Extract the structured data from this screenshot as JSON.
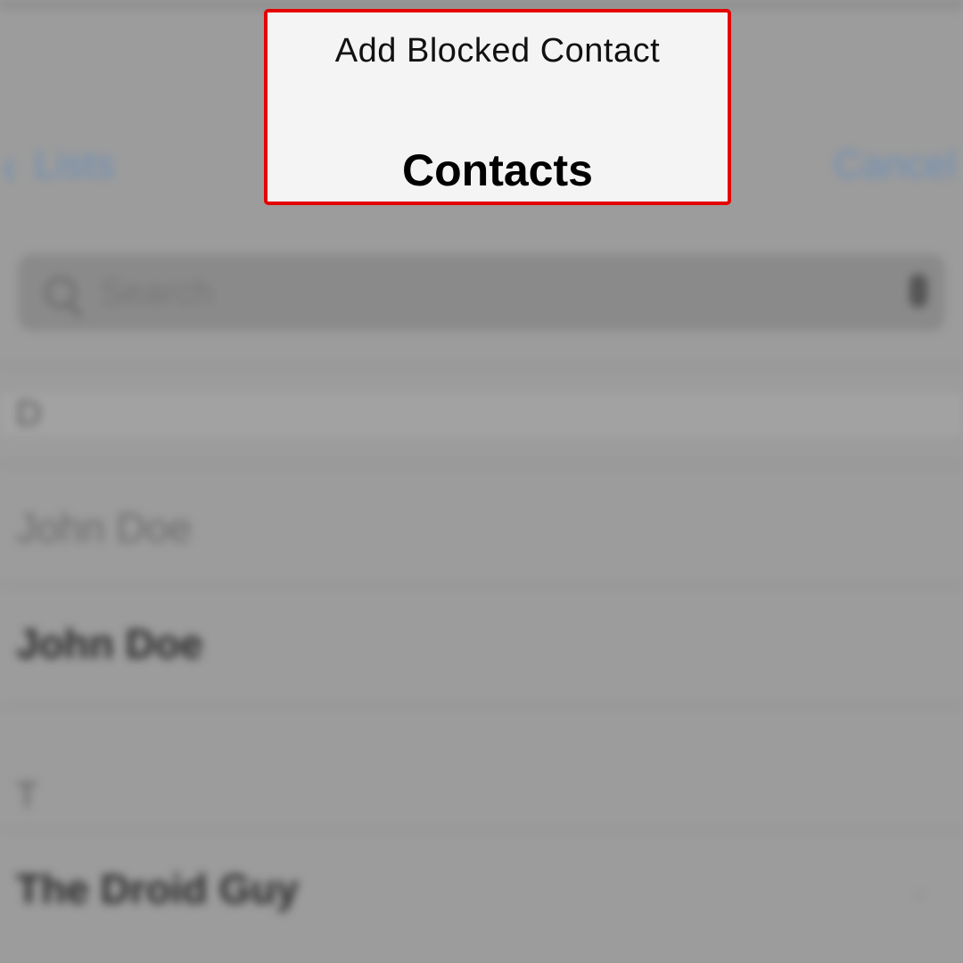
{
  "header": {
    "prompt": "Add Blocked Contact",
    "title": "Contacts"
  },
  "nav": {
    "back_label": "Lists",
    "back_chevron": "‹",
    "cancel_label": "Cancel"
  },
  "search": {
    "placeholder": "Search",
    "icon": "search-icon",
    "mic_icon": "microphone-icon"
  },
  "sections": [
    {
      "letter": "D",
      "contacts": [
        "John Doe",
        "John Doe"
      ]
    },
    {
      "letter": "T",
      "contacts": [
        "The Droid Guy"
      ]
    }
  ],
  "colors": {
    "highlight_border": "#e60000",
    "accent": "#6f8fb5"
  }
}
